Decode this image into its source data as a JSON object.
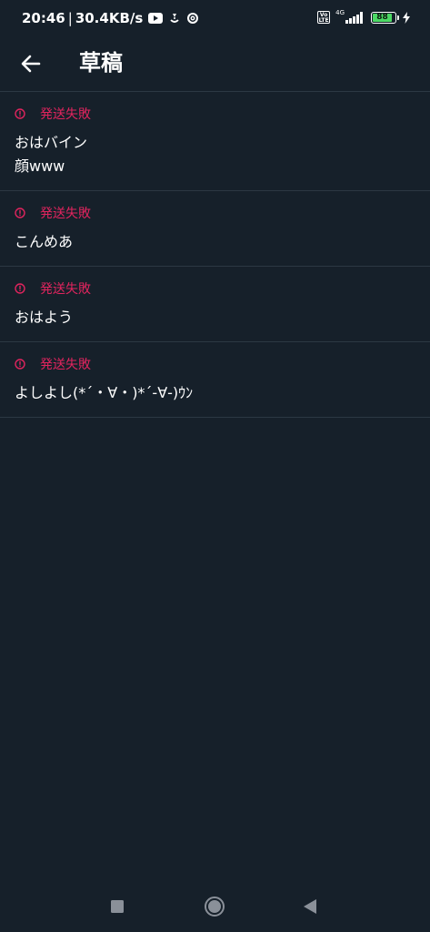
{
  "status_bar": {
    "time": "20:46",
    "separator": "|",
    "net_speed": "30.4KB/s",
    "volte_label": "Vo LTE",
    "network_type": "4G",
    "battery_level": "88",
    "battery_color": "#4cd964",
    "icons": [
      "youtube-icon",
      "app-notification-icon",
      "sync-icon",
      "volte-icon",
      "signal-icon",
      "battery-icon",
      "charging-icon"
    ]
  },
  "header": {
    "title": "草稿",
    "back_icon": "arrow-left-icon"
  },
  "drafts": [
    {
      "status": "発送失敗",
      "text": "おはバイン\n顔www"
    },
    {
      "status": "発送失敗",
      "text": "こんめあ"
    },
    {
      "status": "発送失敗",
      "text": "おはよう"
    },
    {
      "status": "発送失敗",
      "text": "よしよし(*´・∀・)*´-∀-)ｳﾝ"
    }
  ],
  "colors": {
    "background": "#16202a",
    "error": "#e0245e",
    "divider": "#2c3843",
    "text": "#ffffff"
  },
  "nav_bar": {
    "icons": [
      "recents-square-icon",
      "home-circle-icon",
      "back-triangle-icon"
    ]
  }
}
